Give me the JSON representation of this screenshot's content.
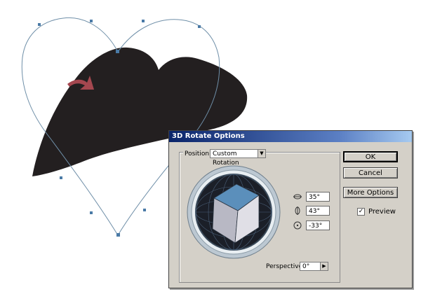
{
  "dialog": {
    "title": "3D Rotate Options",
    "position_label": "Position:",
    "position_value": "Custom Rotation",
    "rotation_x": "35°",
    "rotation_y": "43°",
    "rotation_z": "-33°",
    "perspective_label": "Perspective:",
    "perspective_value": "0°",
    "buttons": {
      "ok": "OK",
      "cancel": "Cancel",
      "more_options": "More Options"
    },
    "preview_label": "Preview",
    "preview_checked": true
  },
  "icons": {
    "dropdown": "chevron-down-icon",
    "stepper": "play-arrow-icon",
    "rotate_x": "rotate-x-axis-icon",
    "rotate_y": "rotate-y-axis-icon",
    "rotate_z": "rotate-z-axis-icon"
  },
  "colors": {
    "heart_fill": "#231f20",
    "path_stroke": "#6f8fa8",
    "arrow": "#a4474f",
    "cube_top": "#5b8fbb",
    "dialog_bg": "#d4d0c8",
    "title_bar": "#0a246a"
  }
}
